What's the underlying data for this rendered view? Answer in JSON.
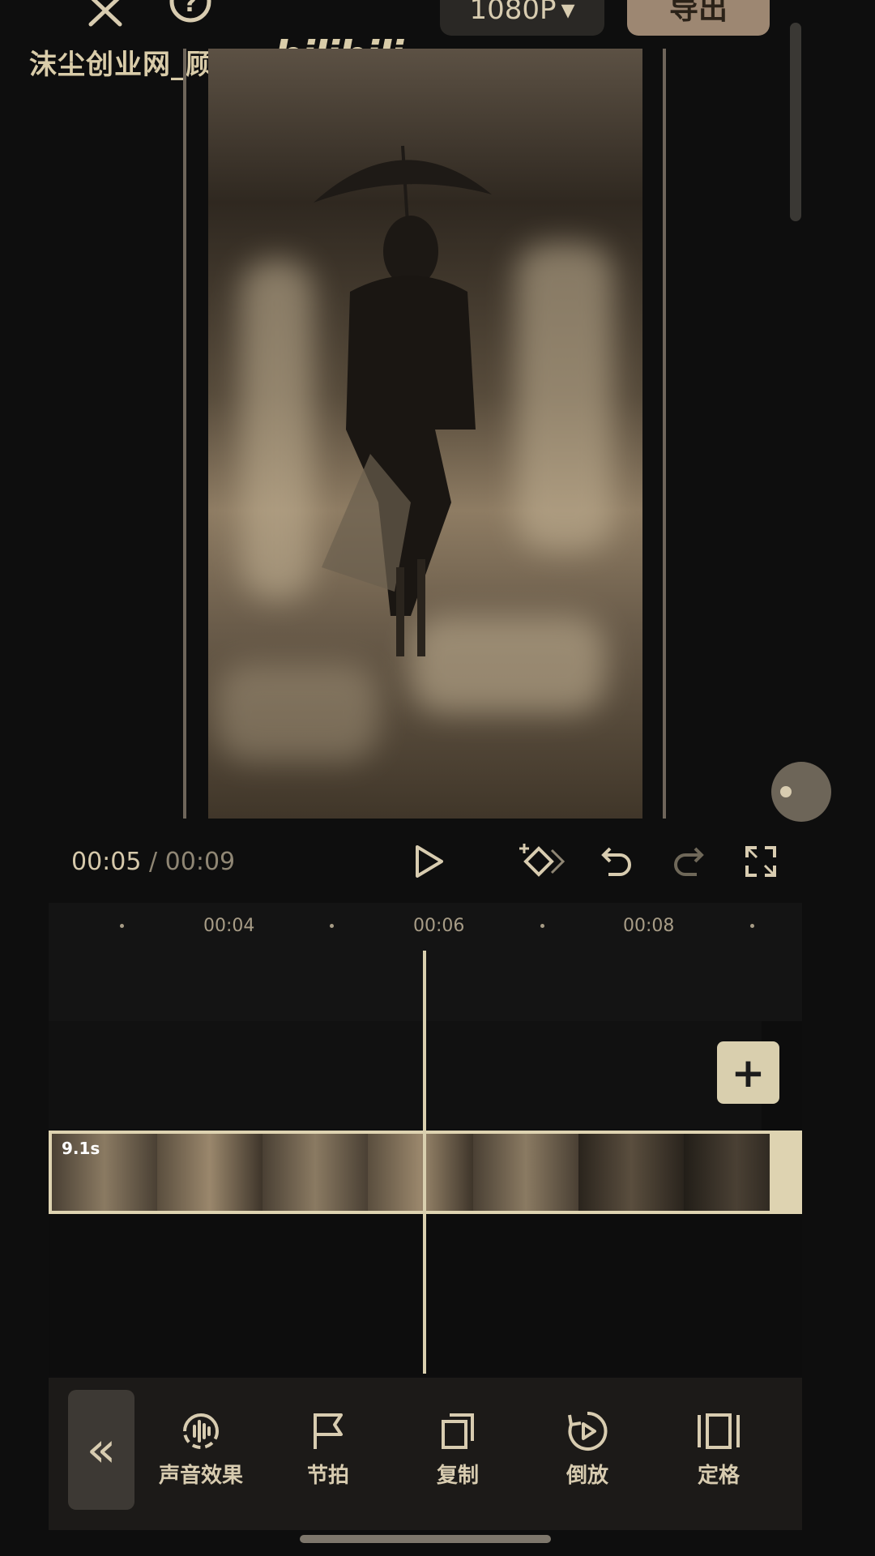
{
  "header": {
    "resolution_label": "1080P",
    "export_label": "导出"
  },
  "watermark": {
    "text": "沫尘创业网_顾北",
    "logo": "bilibili"
  },
  "transport": {
    "current_time": "00:05",
    "separator": " / ",
    "duration": "00:09"
  },
  "timeline": {
    "ticks": [
      "00:04",
      "00:06",
      "00:08"
    ],
    "clip_duration": "9.1s"
  },
  "toolbar": {
    "items": [
      {
        "label": "声音效果",
        "icon": "sound-effect-icon"
      },
      {
        "label": "节拍",
        "icon": "beat-flag-icon"
      },
      {
        "label": "复制",
        "icon": "copy-icon"
      },
      {
        "label": "倒放",
        "icon": "reverse-icon"
      },
      {
        "label": "定格",
        "icon": "freeze-frame-icon"
      }
    ]
  },
  "colors": {
    "accent": "#ded3b1",
    "export": "#9d8772",
    "background": "#0e0e0e"
  }
}
